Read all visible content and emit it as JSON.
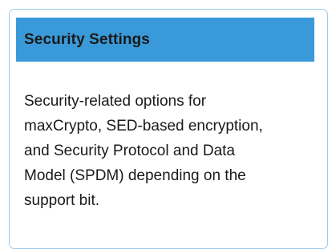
{
  "panel": {
    "title": "Security Settings",
    "description": "Security-related options for\nmaxCrypto, SED-based encryption,\nand Security Protocol and Data\nModel (SPDM) depending on the\nsupport bit."
  }
}
